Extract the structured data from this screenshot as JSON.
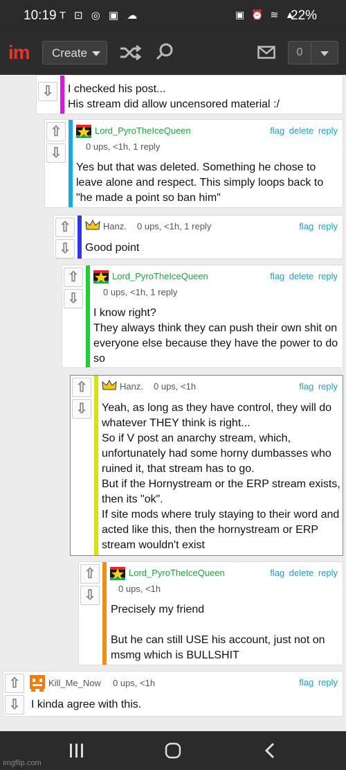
{
  "status": {
    "time": "10:19",
    "battery": "22%",
    "left_icons": "T ⊡ ◎ ▣ ☁",
    "right_icons": "▣ ⏰ ≋ ▲"
  },
  "topbar": {
    "logo_i": "i",
    "logo_m": "m",
    "create_label": "Create",
    "notif_count": "0"
  },
  "comments": [
    {
      "text": "I checked his post...\nHis stream did allow uncensored material :/",
      "bar_color": "#d61ad6"
    },
    {
      "user": "Lord_PyroTheIceQueen",
      "meta": "0 ups, <1h, 1 reply",
      "actions": "flag delete reply",
      "text": "Yes but that was deleted. Something he chose to leave alone and respect. This simply loops back to \"he made a point so ban him\"",
      "bar_color": "#1aa8e0"
    },
    {
      "user": "Hanz.",
      "meta": "0 ups, <1h, 1 reply",
      "actions": "flag reply",
      "text": "Good point",
      "bar_color": "#3333e8"
    },
    {
      "user": "Lord_PyroTheIceQueen",
      "meta": "0 ups, <1h, 1 reply",
      "actions": "flag delete reply",
      "text": "I know right?\nThey always think they can push their own shit on everyone else because they have the power to do so",
      "bar_color": "#1fcf3a"
    },
    {
      "user": "Hanz.",
      "meta": "0 ups, <1h",
      "actions": "flag reply",
      "text": "Yeah, as long as they have control, they will do whatever THEY think is right...\nSo if V post an anarchy stream, which, unfortunately had some horny dumbasses who ruined it, that stream has to go.\nBut if the Hornystream or the ERP stream exists, then its \"ok\".\nIf site mods where truly staying to their word and acted like this, then the hornystream or ERP stream wouldn't exist",
      "bar_color": "#d9e01a"
    },
    {
      "user": "Lord_PyroTheIceQueen",
      "meta": "0 ups, <1h",
      "actions": "flag delete reply",
      "text": "Precisely my friend\n\nBut he can still USE his account, just not on msmg which is BULLSHIT",
      "bar_color": "#f28c12"
    },
    {
      "user": "Kill_Me_Now",
      "meta": "0 ups, <1h",
      "actions": "flag reply",
      "text": "I kinda agree with this."
    }
  ],
  "watermark": "imgflip.com"
}
